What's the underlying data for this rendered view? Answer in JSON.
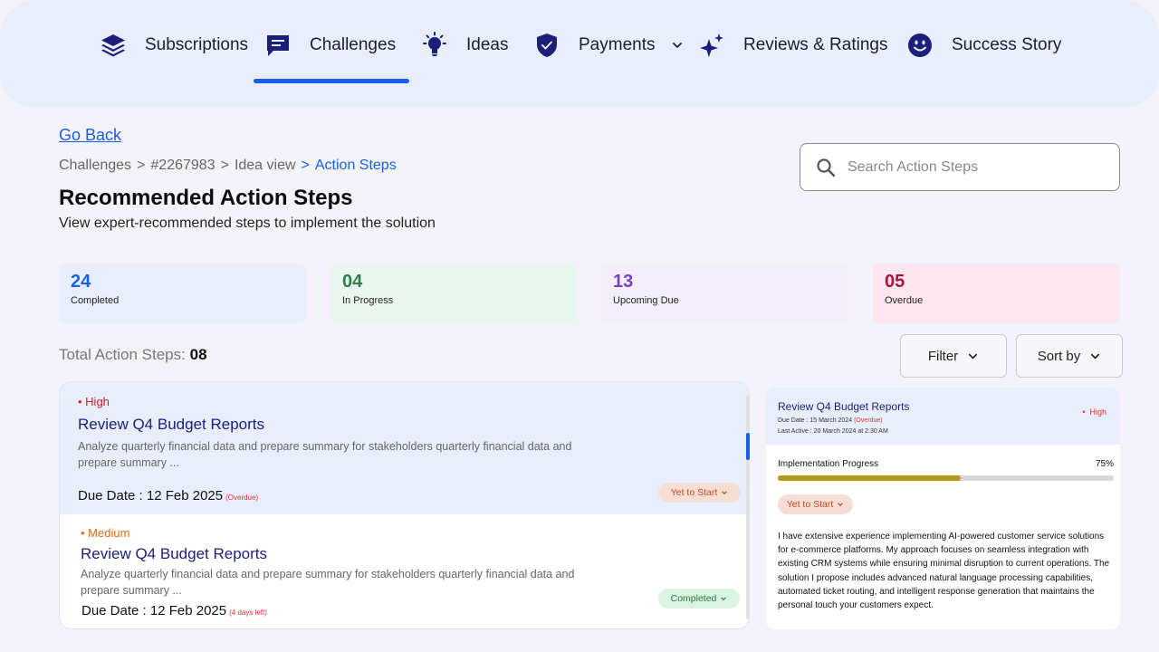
{
  "nav": {
    "items": [
      {
        "label": "Subscriptions",
        "icon": "layers-icon"
      },
      {
        "label": "Challenges",
        "icon": "chat-icon"
      },
      {
        "label": "Ideas",
        "icon": "lightbulb-icon"
      },
      {
        "label": "Payments",
        "icon": "shield-check-icon"
      },
      {
        "label": "Reviews & Ratings",
        "icon": "sparkle-icon"
      },
      {
        "label": "Success Story",
        "icon": "smiley-icon"
      }
    ],
    "active": "Challenges"
  },
  "go_back": "Go Back",
  "breadcrumb": {
    "items": [
      "Challenges",
      "#2267983",
      "Idea view"
    ],
    "separator": ">",
    "current": "Action Steps"
  },
  "page": {
    "title": "Recommended Action Steps",
    "subtitle": "View expert-recommended steps to implement the solution"
  },
  "search": {
    "placeholder": "Search Action Steps"
  },
  "stats": [
    {
      "value": "24",
      "label": "Completed",
      "color": "#1a5ee8",
      "bg": "#e8eefb"
    },
    {
      "value": "04",
      "label": "In Progress",
      "color": "#2f7d4a",
      "bg": "#eaf6ee"
    },
    {
      "value": "13",
      "label": "Upcoming Due",
      "color": "#7a3fc0",
      "bg": "#f3eefb"
    },
    {
      "value": "05",
      "label": "Overdue",
      "color": "#b0103c",
      "bg": "#fde6ee"
    }
  ],
  "total": {
    "label": "Total Action Steps:",
    "value": "08"
  },
  "controls": {
    "filter": "Filter",
    "sort": "Sort by"
  },
  "steps": [
    {
      "priority": "High",
      "priority_color": "#cc2222",
      "title": "Review Q4 Budget Reports",
      "description": "Analyze quarterly financial data and prepare summary for stakeholders quarterly financial data and prepare summary ...",
      "due_label": "Due Date : 12 Feb 2025",
      "due_note": "(Overdue)",
      "status": "Yet to Start",
      "status_bg": "#f6ded6",
      "status_color": "#c04a1c",
      "selected": true
    },
    {
      "priority": "Medium",
      "priority_color": "#e06b10",
      "title": "Review Q4 Budget Reports",
      "description": "Analyze quarterly financial data and prepare summary for stakeholders quarterly financial data and prepare summary ...",
      "due_label": "Due Date : 12 Feb 2025",
      "due_note": "(4 days left)",
      "status": "Completed",
      "status_bg": "#dcf3e3",
      "status_color": "#237a3e",
      "selected": false
    }
  ],
  "detail": {
    "title": "Review Q4 Budget Reports",
    "due_text": "Due Date : 15 March 2024",
    "due_note": "(Overdue)",
    "last_active": "Last Active : 20 March 2024 at 2:30 AM",
    "priority": "High",
    "progress_label": "Implementation Progress",
    "progress_text": "75%",
    "progress_value": 0.545,
    "status": "Yet to Start",
    "body": "I have extensive experience implementing AI-powered customer service solutions for e-commerce platforms. My approach focuses on seamless integration with existing CRM systems while ensuring minimal disruption to current operations. The solution I propose includes advanced natural language processing capabilities, automated ticket routing, and intelligent response generation that maintains the personal touch your customers expect."
  },
  "colors": {
    "accent": "#1a5ee8",
    "nav_bg": "#e8eefb",
    "icon": "#1c1f7a"
  }
}
